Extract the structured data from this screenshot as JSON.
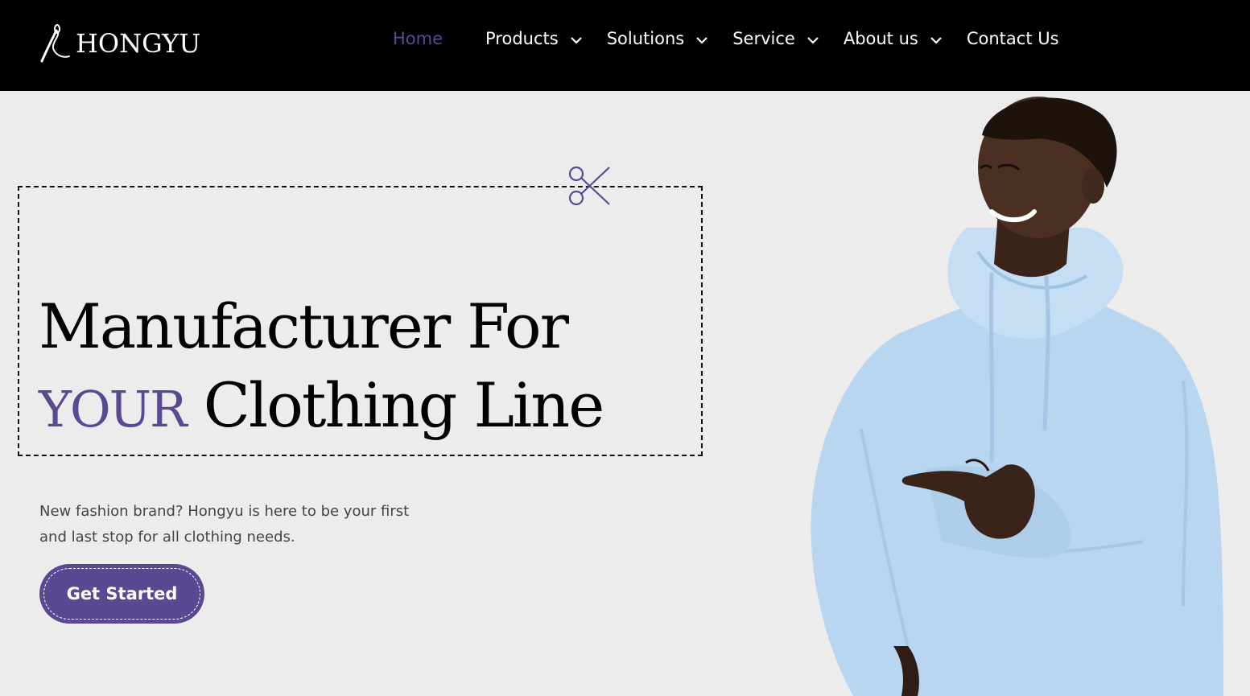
{
  "brand": {
    "name": "HONGYU",
    "logo_icon": "needle-thread-icon"
  },
  "nav": {
    "items": [
      {
        "label": "Home",
        "active": true,
        "has_dropdown": false
      },
      {
        "label": "Products",
        "active": false,
        "has_dropdown": true
      },
      {
        "label": "Solutions",
        "active": false,
        "has_dropdown": true
      },
      {
        "label": "Service",
        "active": false,
        "has_dropdown": true
      },
      {
        "label": "About us",
        "active": false,
        "has_dropdown": true
      },
      {
        "label": "Contact Us",
        "active": false,
        "has_dropdown": false
      }
    ]
  },
  "hero": {
    "headline_line1": "Manufacturer For",
    "headline_accent": "YOUR",
    "headline_line2": "Clothing Line",
    "description": "New fashion brand? Hongyu is here to be your first and last stop for all clothing needs.",
    "cta_label": "Get Started",
    "decor_icon": "scissors-icon",
    "image": "smiling man in light blue hoodie pointing"
  },
  "colors": {
    "accent": "#5a4892",
    "header_bg": "#000000",
    "page_bg": "#ececec",
    "hoodie": "#b9d6f0"
  }
}
